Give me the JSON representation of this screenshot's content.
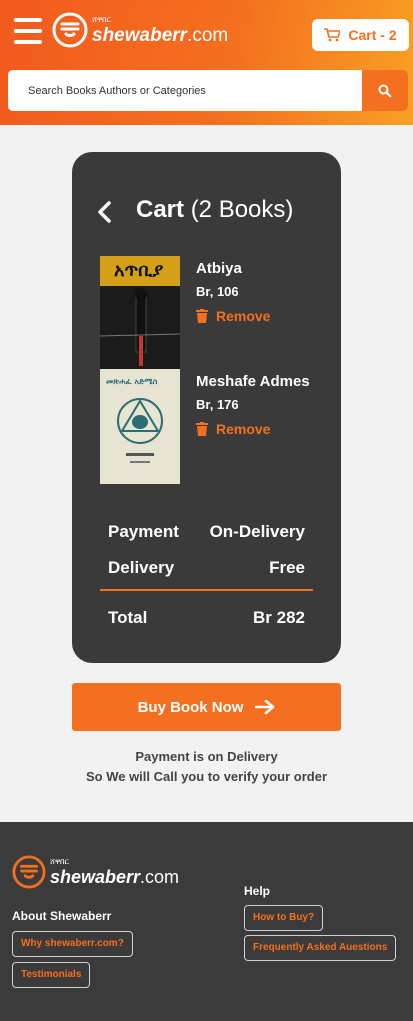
{
  "header": {
    "logo": {
      "amharic": "ሸዋበር",
      "brand": "shewaberr",
      "suffix": ".com"
    },
    "cart_label": "Cart - 2",
    "search_placeholder": "Search Books Authors or Categories",
    "colors": {
      "accent": "#f46f1f",
      "header_start": "#f25a1e",
      "header_end": "#f8a023"
    }
  },
  "cart": {
    "title_word": "Cart",
    "title_count": "(2 Books)",
    "items": [
      {
        "title": "Atbiya",
        "price": "Br, 106",
        "remove_label": "Remove",
        "cover_text": "አጥቢያ"
      },
      {
        "title": "Meshafe Admes",
        "price": "Br, 176",
        "remove_label": "Remove",
        "cover_text": "መጽሐፈ አድሜስ"
      }
    ],
    "payment_label_1": "Payment",
    "payment_label_2": "Delivery",
    "payment_value_1": "On-Delivery",
    "payment_value_2": "Free",
    "total_label": "Total",
    "total_value": "Br 282",
    "card_color": "#3a3a3a"
  },
  "actions": {
    "buy_label": "Buy Book Now",
    "note_line_1": "Payment is on Delivery",
    "note_line_2": "So We will Call you to verify your order"
  },
  "footer": {
    "logo": {
      "amharic": "ሸዋበር",
      "brand": "shewaberr",
      "suffix": ".com"
    },
    "about_heading": "About Shewaberr",
    "about_links": [
      "Why shewaberr.com?",
      "Testimonials"
    ],
    "help_heading": "Help",
    "help_links": [
      "How to Buy?",
      "Frequently Asked Auestions"
    ]
  }
}
